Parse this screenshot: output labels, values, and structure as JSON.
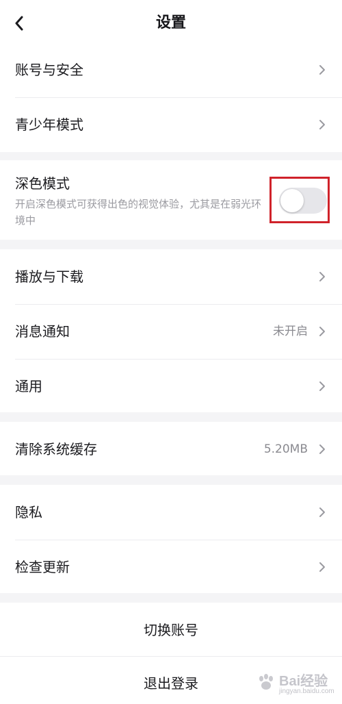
{
  "header": {
    "title": "设置",
    "back_icon": "chevron-left-icon"
  },
  "groups": {
    "account": {
      "items": [
        {
          "label": "账号与安全"
        },
        {
          "label": "青少年模式"
        }
      ]
    },
    "dark_mode": {
      "label": "深色模式",
      "description": "开启深色模式可获得出色的视觉体验，尤其是在弱光环境中",
      "enabled": false
    },
    "media": {
      "items": [
        {
          "label": "播放与下载",
          "value": ""
        },
        {
          "label": "消息通知",
          "value": "未开启"
        },
        {
          "label": "通用",
          "value": ""
        }
      ]
    },
    "cache": {
      "label": "清除系统缓存",
      "value": "5.20MB"
    },
    "other": {
      "items": [
        {
          "label": "隐私"
        },
        {
          "label": "检查更新"
        }
      ]
    }
  },
  "actions": {
    "switch_account": "切换账号",
    "logout": "退出登录"
  },
  "watermark": {
    "text": "Bai经验",
    "sub": "jingyan.baidu.com"
  },
  "colors": {
    "highlight": "#d0222a",
    "toggle_off": "#e6e6ea",
    "secondary_text": "#8a8a90"
  }
}
